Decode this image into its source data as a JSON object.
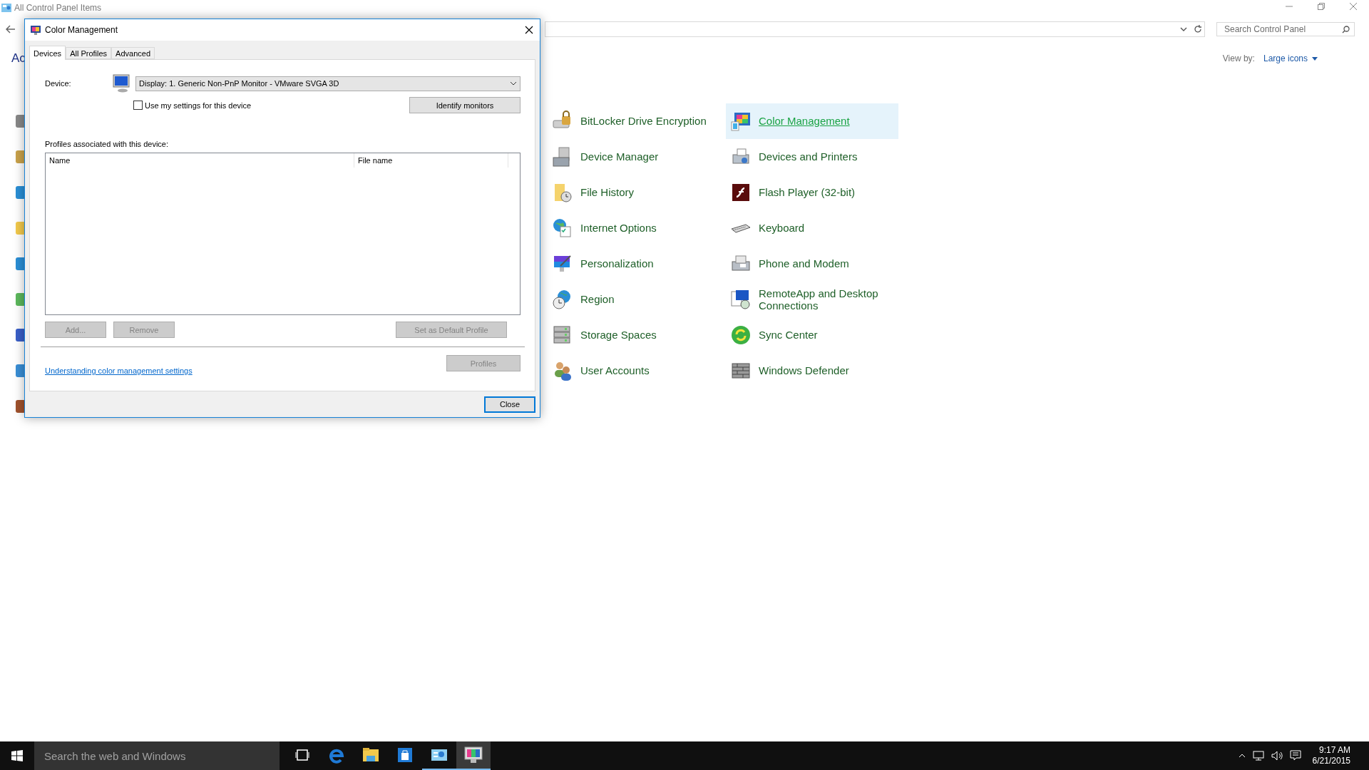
{
  "explorer": {
    "title": "All Control Panel Items",
    "heading_fragment": "Ac",
    "search": {
      "placeholder": "Search Control Panel"
    },
    "view_by": {
      "label": "View by:",
      "value": "Large icons"
    },
    "items": [
      {
        "label": "BitLocker Drive Encryption",
        "selected": false
      },
      {
        "label": "Color Management",
        "selected": true
      },
      {
        "label": "Device Manager",
        "selected": false
      },
      {
        "label": "Devices and Printers",
        "selected": false
      },
      {
        "label": "File History",
        "selected": false
      },
      {
        "label": "Flash Player (32-bit)",
        "selected": false
      },
      {
        "label": "Internet Options",
        "selected": false
      },
      {
        "label": "Keyboard",
        "selected": false
      },
      {
        "label": "Personalization",
        "selected": false
      },
      {
        "label": "Phone and Modem",
        "selected": false
      },
      {
        "label": "Region",
        "selected": false
      },
      {
        "label": "RemoteApp and Desktop Connections",
        "selected": false
      },
      {
        "label": "Storage Spaces",
        "selected": false
      },
      {
        "label": "Sync Center",
        "selected": false
      },
      {
        "label": "User Accounts",
        "selected": false
      },
      {
        "label": "Windows Defender",
        "selected": false
      }
    ]
  },
  "dialog": {
    "title": "Color Management",
    "tabs": [
      {
        "label": "Devices",
        "selected": true
      },
      {
        "label": "All Profiles",
        "selected": false
      },
      {
        "label": "Advanced",
        "selected": false
      }
    ],
    "device_label": "Device:",
    "device": {
      "value": "Display: 1. Generic Non-PnP Monitor - VMware SVGA 3D"
    },
    "use_my_settings": {
      "label": "Use my settings for this device",
      "checked": false
    },
    "identify_button": {
      "label": "Identify monitors",
      "disabled": false
    },
    "profiles_label": "Profiles associated with this device:",
    "table": {
      "columns": [
        "Name",
        "File name"
      ]
    },
    "list_buttons": [
      {
        "label": "Add...",
        "disabled": true
      },
      {
        "label": "Remove",
        "disabled": true
      },
      {
        "label": "Set as Default Profile",
        "disabled": true
      }
    ],
    "link": "Understanding color management settings",
    "profiles_button": {
      "label": "Profiles",
      "disabled": true
    },
    "close_button": {
      "label": "Close",
      "disabled": false
    }
  },
  "taskbar": {
    "search": {
      "placeholder": "Search the web and Windows"
    },
    "apps": [
      {
        "kind": "taskview",
        "running": false,
        "selected": false
      },
      {
        "kind": "browser",
        "running": false,
        "selected": false
      },
      {
        "kind": "folder",
        "running": false,
        "selected": false
      },
      {
        "kind": "store",
        "running": false,
        "selected": false
      },
      {
        "kind": "controlpanel",
        "running": true,
        "selected": false
      },
      {
        "kind": "monitor",
        "running": true,
        "selected": true
      }
    ],
    "time": "9:17 AM",
    "date": "6/21/2015"
  }
}
